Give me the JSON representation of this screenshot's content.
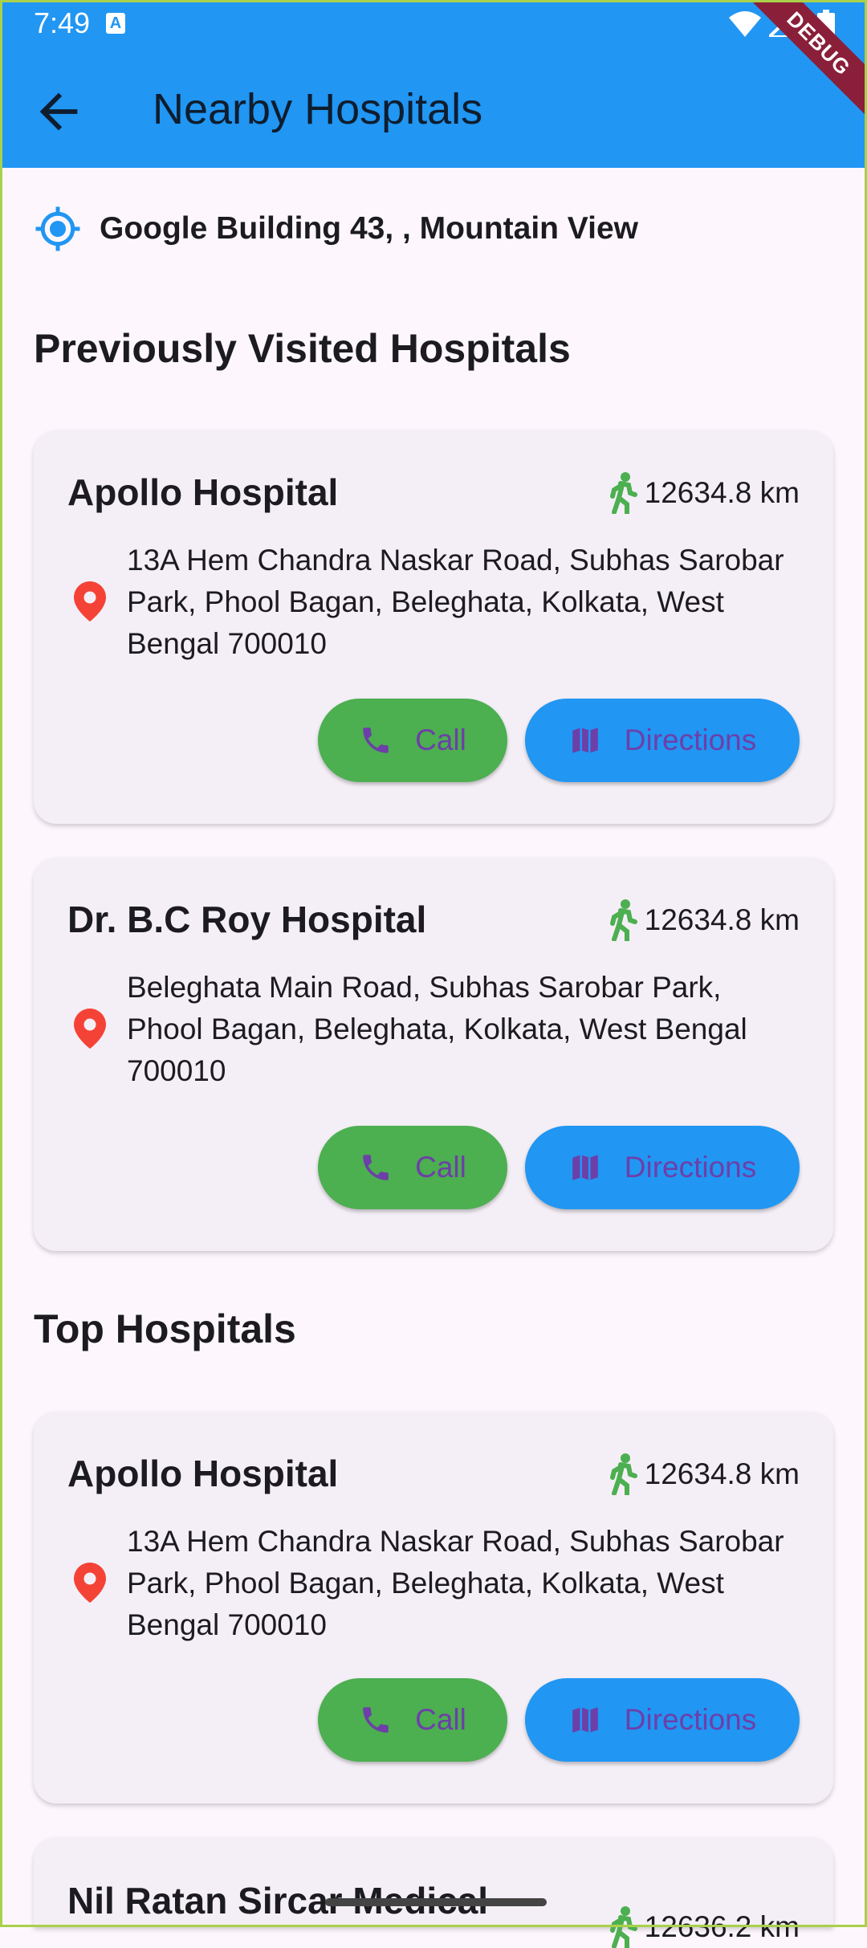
{
  "status_bar": {
    "time": "7:49",
    "badge": "A"
  },
  "debug_ribbon": "DEBUG",
  "app_bar": {
    "title": "Nearby Hospitals"
  },
  "location": {
    "text": "Google Building 43, , Mountain View"
  },
  "sections": {
    "previous": {
      "title": "Previously Visited Hospitals",
      "cards": [
        {
          "name": "Apollo Hospital",
          "distance": "12634.8 km",
          "address": "13A Hem Chandra Naskar Road, Subhas Sarobar Park, Phool Bagan, Beleghata, Kolkata, West Bengal 700010",
          "call_label": "Call",
          "directions_label": "Directions"
        },
        {
          "name": "Dr. B.C Roy Hospital",
          "distance": "12634.8 km",
          "address": "Beleghata Main Road, Subhas Sarobar Park, Phool Bagan, Beleghata, Kolkata, West Bengal 700010",
          "call_label": "Call",
          "directions_label": "Directions"
        }
      ]
    },
    "top": {
      "title": "Top Hospitals",
      "cards": [
        {
          "name": "Apollo Hospital",
          "distance": "12634.8 km",
          "address": "13A Hem Chandra Naskar Road, Subhas Sarobar Park, Phool Bagan, Beleghata, Kolkata, West Bengal 700010",
          "call_label": "Call",
          "directions_label": "Directions"
        },
        {
          "name": "Nil Ratan Sircar Medical",
          "distance": "12636.2 km"
        }
      ]
    }
  },
  "colors": {
    "app_bar": "#2196f3",
    "call_button": "#4caf50",
    "directions_button": "#2196f3",
    "button_text": "#6d3fa8",
    "pin": "#f44336",
    "walk": "#4caf50",
    "location_icon": "#2196f3",
    "debug_ribbon": "#8a1f3a"
  },
  "icons": [
    "back-arrow-icon",
    "my-location-icon",
    "walking-icon",
    "location-pin-icon",
    "phone-icon",
    "map-icon",
    "wifi-icon",
    "signal-icon",
    "battery-icon"
  ]
}
